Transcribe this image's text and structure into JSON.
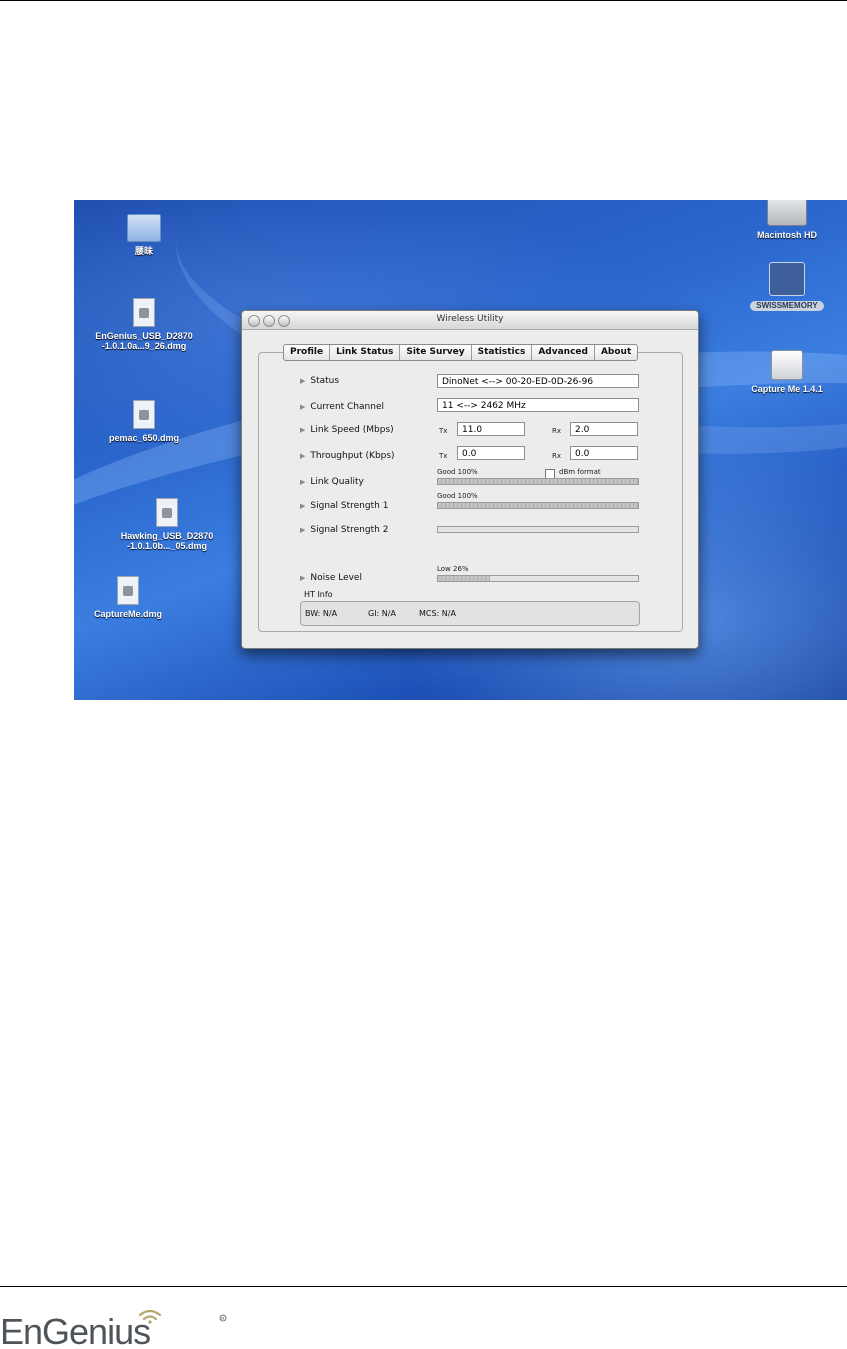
{
  "desktop": {
    "icons": [
      {
        "label": "腰昧"
      },
      {
        "label": "EnGenius_USB_D2870\n-1.0.1.0a...9_26.dmg"
      },
      {
        "label": "pemac_650.dmg"
      },
      {
        "label": "Hawking_USB_D2870\n-1.0.1.0b..._05.dmg"
      },
      {
        "label": "CaptureMe.dmg"
      },
      {
        "label": "Macintosh HD"
      },
      {
        "label": "SWISSMEMORY"
      },
      {
        "label": "Capture Me 1.4.1"
      }
    ]
  },
  "window": {
    "title": "Wireless Utility",
    "tabs": [
      "Profile",
      "Link Status",
      "Site Survey",
      "Statistics",
      "Advanced",
      "About"
    ],
    "active_tab": "Link Status",
    "rows": {
      "status_label": "Status",
      "status_value": "DinoNet <--> 00-20-ED-0D-26-96",
      "channel_label": "Current Channel",
      "channel_value": "11 <--> 2462 MHz",
      "link_speed_label": "Link Speed  (Mbps)",
      "link_speed_tx_label": "Tx",
      "link_speed_tx": "11.0",
      "link_speed_rx_label": "Rx",
      "link_speed_rx": "2.0",
      "throughput_label": "Throughput (Kbps)",
      "throughput_tx_label": "Tx",
      "throughput_tx": "0.0",
      "throughput_rx_label": "Rx",
      "throughput_rx": "0.0",
      "link_quality_label": "Link Quality",
      "link_quality_text": "Good 100%",
      "link_quality_level": 1.0,
      "dbm_format_label": "dBm format",
      "signal1_label": "Signal Strength 1",
      "signal1_text": "Good 100%",
      "signal1_level": 1.0,
      "signal2_label": "Signal Strength 2",
      "signal2_level": 0,
      "noise_label": "Noise Level",
      "noise_text": "Low 26%",
      "noise_level": 0.26
    },
    "ht_info": {
      "title": "HT Info",
      "bw": "BW: N/A",
      "gi": "GI: N/A",
      "mcs": "MCS: N/A"
    }
  },
  "footer": {
    "logo_text": "EnGenius"
  }
}
